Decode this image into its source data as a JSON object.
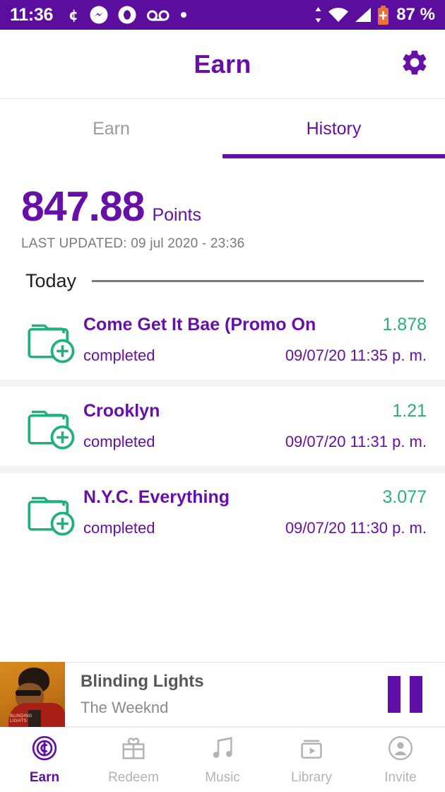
{
  "status_bar": {
    "time": "11:36",
    "battery_text": "87 %",
    "left_icons": [
      "cent-icon",
      "messenger-icon",
      "opera-icon",
      "voicemail-icon",
      "dot-icon"
    ],
    "right_icons": [
      "data-transfer-icon",
      "wifi-icon",
      "cellular-signal-icon",
      "battery-charging-icon"
    ],
    "background_color": "#5B0E9E"
  },
  "header": {
    "title": "Earn",
    "settings_icon": "gear-icon",
    "accent_color": "#6710A8"
  },
  "tabs": [
    {
      "label": "Earn",
      "active": false
    },
    {
      "label": "History",
      "active": true
    }
  ],
  "points": {
    "value": "847.88",
    "unit": "Points",
    "last_updated": "LAST UPDATED: 09 jul 2020 - 23:36"
  },
  "section": {
    "title": "Today"
  },
  "history": [
    {
      "icon": "folder-plus-icon",
      "title": "Come Get It Bae (Promo On",
      "points": "1.878",
      "status": "completed",
      "timestamp": "09/07/20 11:35 p. m."
    },
    {
      "icon": "folder-plus-icon",
      "title": "Crooklyn",
      "points": "1.21",
      "status": "completed",
      "timestamp": "09/07/20 11:31 p. m."
    },
    {
      "icon": "folder-plus-icon",
      "title": "N.Y.C. Everything",
      "points": "3.077",
      "status": "completed",
      "timestamp": "09/07/20 11:30 p. m."
    }
  ],
  "now_playing": {
    "title": "Blinding Lights",
    "artist": "The Weeknd",
    "album_art": "album-art-blinding-lights",
    "control_icon": "pause-icon"
  },
  "bottom_nav": [
    {
      "label": "Earn",
      "icon": "coin-cent-icon",
      "active": true
    },
    {
      "label": "Redeem",
      "icon": "gift-icon",
      "active": false
    },
    {
      "label": "Music",
      "icon": "music-note-icon",
      "active": false
    },
    {
      "label": "Library",
      "icon": "library-play-icon",
      "active": false
    },
    {
      "label": "Invite",
      "icon": "person-circle-icon",
      "active": false
    }
  ],
  "colors": {
    "purple": "#6710A8",
    "purple_dark": "#5B0E9E",
    "green": "#2BB07A",
    "gray": "#9a9a9a"
  }
}
